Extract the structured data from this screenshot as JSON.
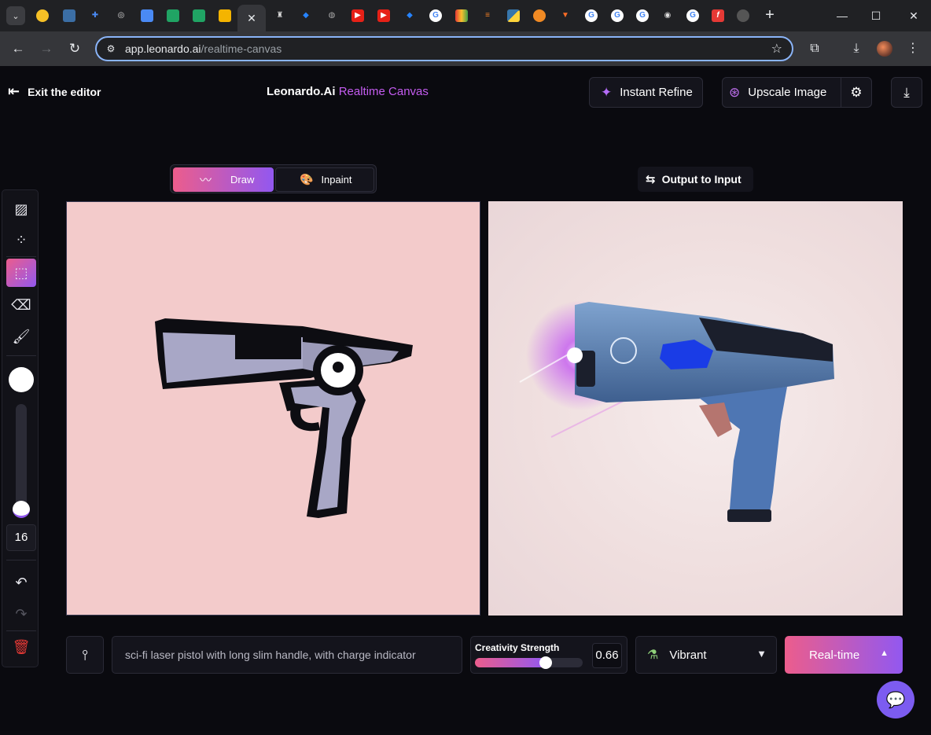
{
  "browser": {
    "url_host": "app.leonardo.ai",
    "url_path": "/realtime-canvas",
    "active_tab_close": "✕",
    "new_tab": "+"
  },
  "header": {
    "exit_label": "Exit the editor",
    "brand_name": "Leonardo.Ai",
    "brand_product": "Realtime Canvas",
    "instant_refine_label": "Instant Refine",
    "upscale_label": "Upscale Image"
  },
  "modes": {
    "draw_label": "Draw",
    "inpaint_label": "Inpaint",
    "selected": "Draw"
  },
  "output_to_input_label": "Output to Input",
  "tools": {
    "brush_size": "16",
    "brush_color": "#ffffff"
  },
  "prompt": {
    "text": "sci-fi  laser pistol with long slim handle, with charge indicator"
  },
  "creativity": {
    "label": "Creativity Strength",
    "value": "0.66",
    "level": 0.66
  },
  "style": {
    "selected": "Vibrant"
  },
  "generate": {
    "label": "Real-time"
  },
  "colors": {
    "accent_start": "#ec5d8c",
    "accent_end": "#9258f0",
    "input_canvas_bg": "#f3cbcb"
  }
}
